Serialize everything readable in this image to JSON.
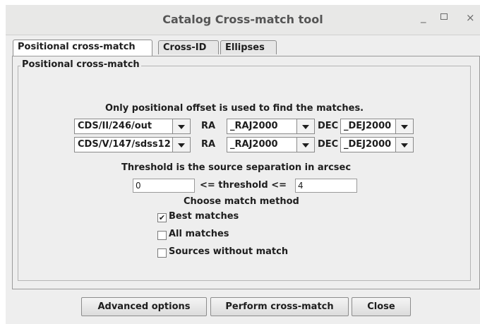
{
  "window": {
    "title": "Catalog Cross-match tool",
    "minimize_glyph": "_",
    "close_glyph": "×"
  },
  "tabs": [
    {
      "label": "Positional cross-match",
      "active": true
    },
    {
      "label": "Cross-ID",
      "active": false
    },
    {
      "label": "Ellipses",
      "active": false
    }
  ],
  "panel": {
    "group_title": "Positional cross-match",
    "info": "Only positional offset is used to find the matches.",
    "ra_label": "RA",
    "dec_label": "DEC",
    "rows": [
      {
        "catalog": "CDS/II/246/out",
        "ra": "_RAJ2000",
        "dec": "_DEJ2000"
      },
      {
        "catalog": "CDS/V/147/sdss12",
        "ra": "_RAJ2000",
        "dec": "_DEJ2000"
      }
    ],
    "threshold_title": "Threshold is the source separation in arcsec",
    "threshold_min": "0",
    "threshold_mid": "<= threshold <=",
    "threshold_max": "4",
    "method_title": "Choose match method",
    "options": [
      {
        "label": "Best matches",
        "checked": true
      },
      {
        "label": "All matches",
        "checked": false
      },
      {
        "label": "Sources without match",
        "checked": false
      }
    ]
  },
  "buttons": {
    "advanced": "Advanced options",
    "perform": "Perform cross-match",
    "close": "Close"
  }
}
